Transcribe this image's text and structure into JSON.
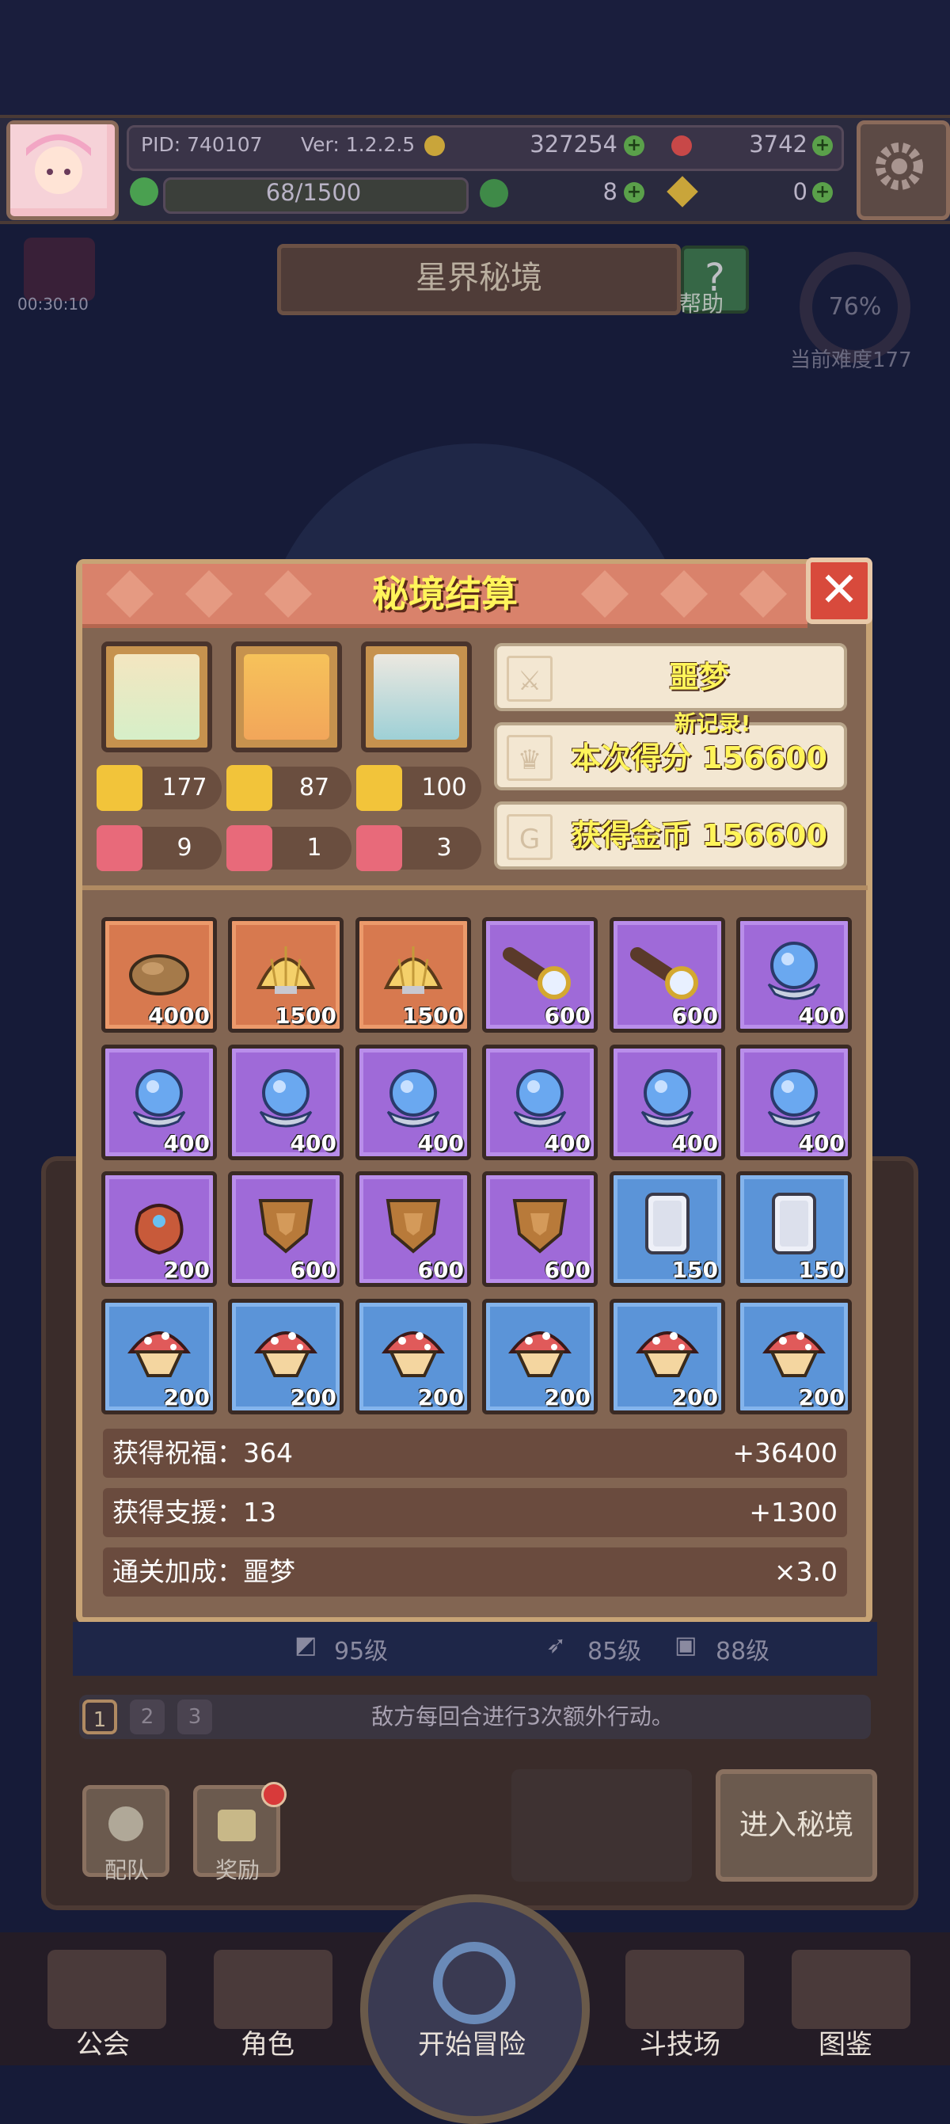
{
  "hud": {
    "pid": "PID: 740107",
    "version": "Ver: 1.2.2.5",
    "gold": "327254",
    "gems": "3742",
    "stamina": "68/1500",
    "clover": "8",
    "keys": "0"
  },
  "screen": {
    "title": "星界秘境",
    "help_label": "帮助",
    "timer": "00:30:10",
    "progress_percent": "76%",
    "current_difficulty": "当前难度177"
  },
  "modal": {
    "title": "秘境结算",
    "close_symbol": "✕",
    "heroes": [
      {
        "power": "177",
        "level": "9"
      },
      {
        "power": "87",
        "level": "1"
      },
      {
        "power": "100",
        "level": "3"
      }
    ],
    "difficulty_label": "噩梦",
    "new_record": "新记录!",
    "score_text": "本次得分 156600",
    "coins_text": "获得金币 156600",
    "rewards": [
      {
        "icon": "ore-rock-icon",
        "rarity": "orange",
        "qty": "4000"
      },
      {
        "icon": "golden-shell-icon",
        "rarity": "orange",
        "qty": "1500"
      },
      {
        "icon": "golden-shell-icon",
        "rarity": "orange",
        "qty": "1500"
      },
      {
        "icon": "spyglass-icon",
        "rarity": "purple",
        "qty": "600"
      },
      {
        "icon": "spyglass-icon",
        "rarity": "purple",
        "qty": "600"
      },
      {
        "icon": "crystal-orb-icon",
        "rarity": "purple",
        "qty": "400"
      },
      {
        "icon": "crystal-orb-icon",
        "rarity": "purple",
        "qty": "400"
      },
      {
        "icon": "crystal-orb-icon",
        "rarity": "purple",
        "qty": "400"
      },
      {
        "icon": "crystal-orb-icon",
        "rarity": "purple",
        "qty": "400"
      },
      {
        "icon": "crystal-orb-icon",
        "rarity": "purple",
        "qty": "400"
      },
      {
        "icon": "crystal-orb-icon",
        "rarity": "purple",
        "qty": "400"
      },
      {
        "icon": "crystal-orb-icon",
        "rarity": "purple",
        "qty": "400"
      },
      {
        "icon": "treasure-bag-icon",
        "rarity": "purple",
        "qty": "200"
      },
      {
        "icon": "leather-shield-icon",
        "rarity": "purple",
        "qty": "600"
      },
      {
        "icon": "leather-shield-icon",
        "rarity": "purple",
        "qty": "600"
      },
      {
        "icon": "leather-shield-icon",
        "rarity": "purple",
        "qty": "600"
      },
      {
        "icon": "white-gem-icon",
        "rarity": "blue",
        "qty": "150"
      },
      {
        "icon": "white-gem-icon",
        "rarity": "blue",
        "qty": "150"
      },
      {
        "icon": "mushroom-icon",
        "rarity": "blue",
        "qty": "200"
      },
      {
        "icon": "mushroom-icon",
        "rarity": "blue",
        "qty": "200"
      },
      {
        "icon": "mushroom-icon",
        "rarity": "blue",
        "qty": "200"
      },
      {
        "icon": "mushroom-icon",
        "rarity": "blue",
        "qty": "200"
      },
      {
        "icon": "mushroom-icon",
        "rarity": "blue",
        "qty": "200"
      },
      {
        "icon": "mushroom-icon",
        "rarity": "blue",
        "qty": "200"
      }
    ],
    "summary": [
      {
        "label": "获得祝福：364",
        "value": "+36400"
      },
      {
        "label": "获得支援：13",
        "value": "+1300"
      },
      {
        "label": "通关加成：噩梦",
        "value": "×3.0"
      }
    ]
  },
  "below": {
    "level_a": "95级",
    "level_b": "85级",
    "level_c": "88级",
    "pages": [
      "1",
      "2",
      "3"
    ],
    "hint": "敌方每回合进行3次额外行动。",
    "team_label": "配队",
    "reward_label": "奖励",
    "enter_label": "进入秘境"
  },
  "nav": {
    "guild": "公会",
    "characters": "角色",
    "start": "开始冒险",
    "arena": "斗技场",
    "codex": "图鉴"
  },
  "colors": {
    "header_red": "#d9826b",
    "modal_brown": "#826552",
    "highlight_yellow": "#fff45a",
    "rarity_orange": "#d7794f",
    "rarity_purple": "#9f6ad8",
    "rarity_blue": "#5b94d8"
  }
}
